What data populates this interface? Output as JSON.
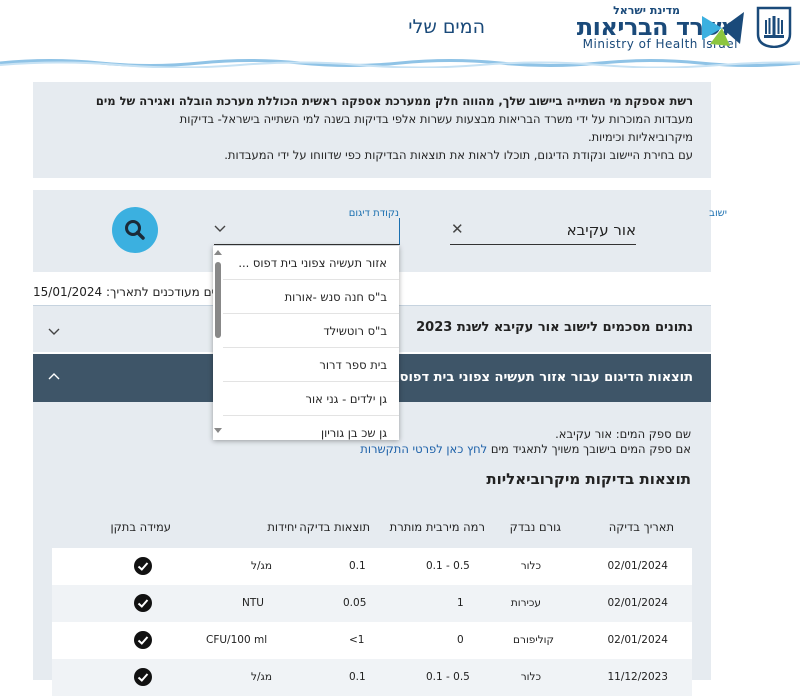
{
  "header": {
    "page_name": "המים שלי",
    "logo_state": "מדינת ישראל",
    "logo_ministry": "משרד הבריאות",
    "logo_english": "Ministry of Health Israel"
  },
  "intro": {
    "line1": "רשת אספקת מי השתייה ביישוב שלך, מהווה חלק ממערכת אספקה ראשית הכוללת מערכת הובלה ואגירה של מים",
    "line2": "מעבדות המוכרות על ידי משרד הבריאות מבצעות עשרות אלפי בדיקות בשנה למי השתייה בישראל- בדיקות",
    "line3": "מיקרוביאליות וכימיות.",
    "line4": "עם בחירת היישוב ונקודת הדיגום, תוכלו לראות את תוצאות הבדיקות כפי שדווחו על ידי המעבדות."
  },
  "search": {
    "city_label": "ישוב",
    "city_value": "אור עקיבא",
    "sample_label": "נקודת דיגום",
    "dropdown_items": [
      "אזור תעשיה צפוני בית דפוס ...",
      "ב\"ס חנה סנש -אורות",
      "ב\"ס רוטשילד",
      "בית ספר דרור",
      "גן ילדים - גני אור",
      "גן שכ בן גוריון"
    ]
  },
  "updated_text": "הנתונים מעודכנים לתאריך: 15/01/2024",
  "accordion_summary_title": "נתונים מסכמים לישוב אור עקיבא לשנת 2023",
  "accordion_results_title": "תוצאות הדיגום עבור אזור תעשיה צפוני בית דפוס פ",
  "provider": {
    "line1": "שם ספק המים: אור עקיבא.",
    "line2_prefix": "אם ספק המים בישובך משויך לתאגיד מים",
    "line2_link": "לחץ כאן לפרטי התקשרות"
  },
  "micro_title": "תוצאות בדיקות מיקרוביאליות",
  "table": {
    "headers": [
      "תאריך בדיקה",
      "גורם נבדק",
      "רמה מירבית מותרת",
      "תוצאות בדיקה",
      "יחידות",
      "עמידה בתקן"
    ],
    "rows": [
      [
        "02/01/2024",
        "כלור",
        "0.1 - 0.5",
        "0.1",
        "מג/ל"
      ],
      [
        "02/01/2024",
        "עכירות",
        "1",
        "0.05",
        "NTU"
      ],
      [
        "02/01/2024",
        "קוליפורם",
        "0",
        "<1",
        "CFU/100 ml"
      ],
      [
        "11/12/2023",
        "כלור",
        "0.1 - 0.5",
        "0.1",
        "מג/ל"
      ]
    ]
  },
  "colors": {
    "brand_blue": "#1a4a7a",
    "accent": "#3bb0e0",
    "panel": "#e6ebf0",
    "dark_header": "#3e5568"
  }
}
